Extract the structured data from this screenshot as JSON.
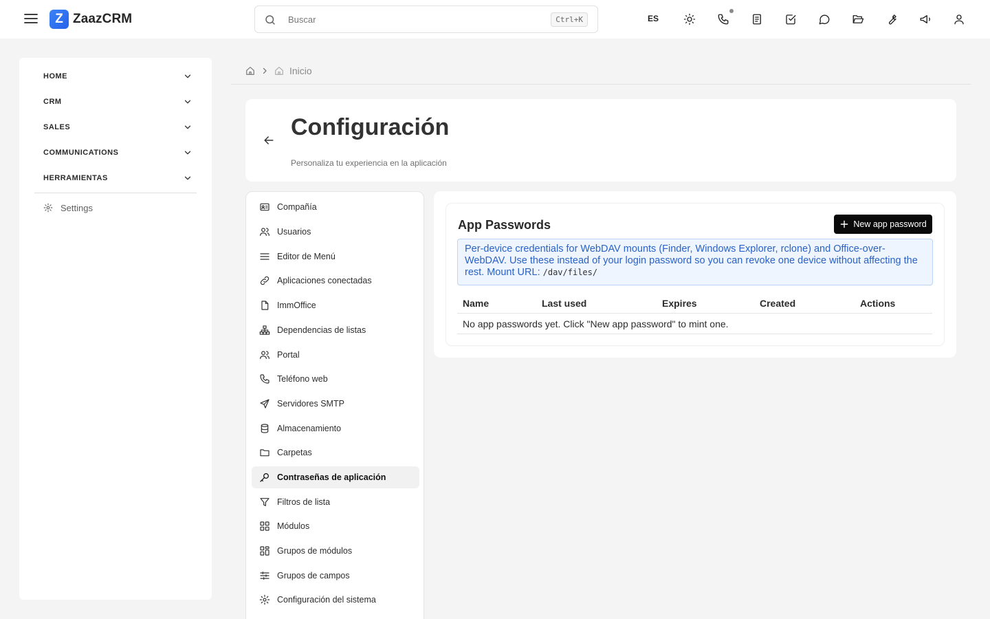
{
  "app": {
    "name": "ZaazCRM",
    "logo_letter": "Z",
    "brand_color": "#2563eb"
  },
  "search": {
    "placeholder": "Buscar",
    "shortcut": "Ctrl+K"
  },
  "topbar": {
    "language": "ES",
    "icons": [
      "sun-icon",
      "phone-icon",
      "document-icon",
      "check-square-icon",
      "chat-icon",
      "folder-open-icon",
      "wrench-icon",
      "megaphone-icon",
      "user-icon"
    ]
  },
  "sidebar": {
    "sections": [
      {
        "label": "HOME"
      },
      {
        "label": "CRM"
      },
      {
        "label": "SALES"
      },
      {
        "label": "COMMUNICATIONS"
      },
      {
        "label": "HERRAMIENTAS"
      }
    ],
    "settings_label": "Settings"
  },
  "breadcrumb": {
    "current": "Inicio"
  },
  "page": {
    "title": "Configuración",
    "subtitle": "Personaliza tu experiencia en la aplicación"
  },
  "settings_menu": {
    "items": [
      {
        "label": "Compañía",
        "icon": "id-card-icon"
      },
      {
        "label": "Usuarios",
        "icon": "users-icon"
      },
      {
        "label": "Editor de Menú",
        "icon": "menu-lines-icon"
      },
      {
        "label": "Aplicaciones conectadas",
        "icon": "link-icon"
      },
      {
        "label": "ImmOffice",
        "icon": "file-icon"
      },
      {
        "label": "Dependencias de listas",
        "icon": "hierarchy-icon"
      },
      {
        "label": "Portal",
        "icon": "users-icon"
      },
      {
        "label": "Teléfono web",
        "icon": "phone-icon"
      },
      {
        "label": "Servidores SMTP",
        "icon": "send-icon"
      },
      {
        "label": "Almacenamiento",
        "icon": "database-icon"
      },
      {
        "label": "Carpetas",
        "icon": "folder-icon"
      },
      {
        "label": "Contraseñas de aplicación",
        "icon": "key-icon",
        "active": true
      },
      {
        "label": "Filtros de lista",
        "icon": "filter-icon"
      },
      {
        "label": "Módulos",
        "icon": "grid-icon"
      },
      {
        "label": "Grupos de módulos",
        "icon": "grid-group-icon"
      },
      {
        "label": "Grupos de campos",
        "icon": "sliders-icon"
      },
      {
        "label": "Configuración del sistema",
        "icon": "gear-icon"
      }
    ]
  },
  "app_passwords": {
    "title": "App Passwords",
    "new_button": "New app password",
    "info_text": "Per-device credentials for WebDAV mounts (Finder, Windows Explorer, rclone) and Office-over-WebDAV. Use these instead of your login password so you can revoke one device without affecting the rest. Mount URL: ",
    "mount_url": "/dav/files/",
    "columns": [
      "Name",
      "Last used",
      "Expires",
      "Created",
      "Actions"
    ],
    "empty_message": "No app passwords yet. Click \"New app password\" to mint one."
  }
}
